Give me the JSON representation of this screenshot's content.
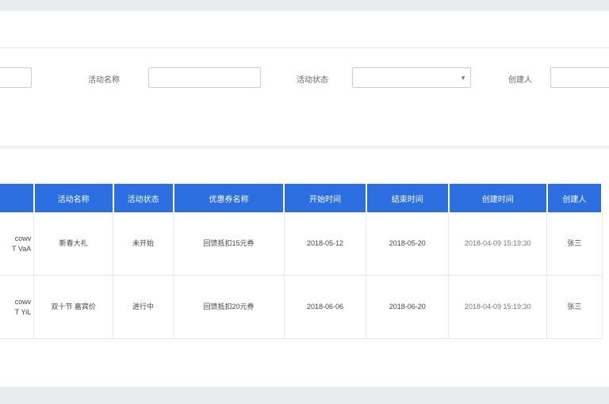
{
  "filters": {
    "activity_name_label": "活动名称",
    "activity_status_label": "活动状态",
    "creator_label": "创建人",
    "activity_name_value": "",
    "activity_status_value": "",
    "creator_value": ""
  },
  "table": {
    "columns": [
      "",
      "活动名称",
      "活动状态",
      "优惠券名称",
      "开始时间",
      "结束时间",
      "创建时间",
      "创建人"
    ],
    "rows": [
      {
        "code_line1": "cowv",
        "code_line2": "T VaA",
        "name": "新春大礼",
        "status": "未开始",
        "coupon": "回馈抵扣15元券",
        "start": "2018-05-12",
        "end": "2018-05-20",
        "created": "2018-04-09 15:19:30",
        "creator": "张三"
      },
      {
        "code_line1": "cowv",
        "code_line2": "T YiL",
        "name": "双十节 嘉宾价",
        "status": "进行中",
        "coupon": "回馈抵扣20元券",
        "start": "2018-06-06",
        "end": "2018-06-20",
        "created": "2018-04-09 15:19:30",
        "creator": "张三"
      }
    ]
  }
}
